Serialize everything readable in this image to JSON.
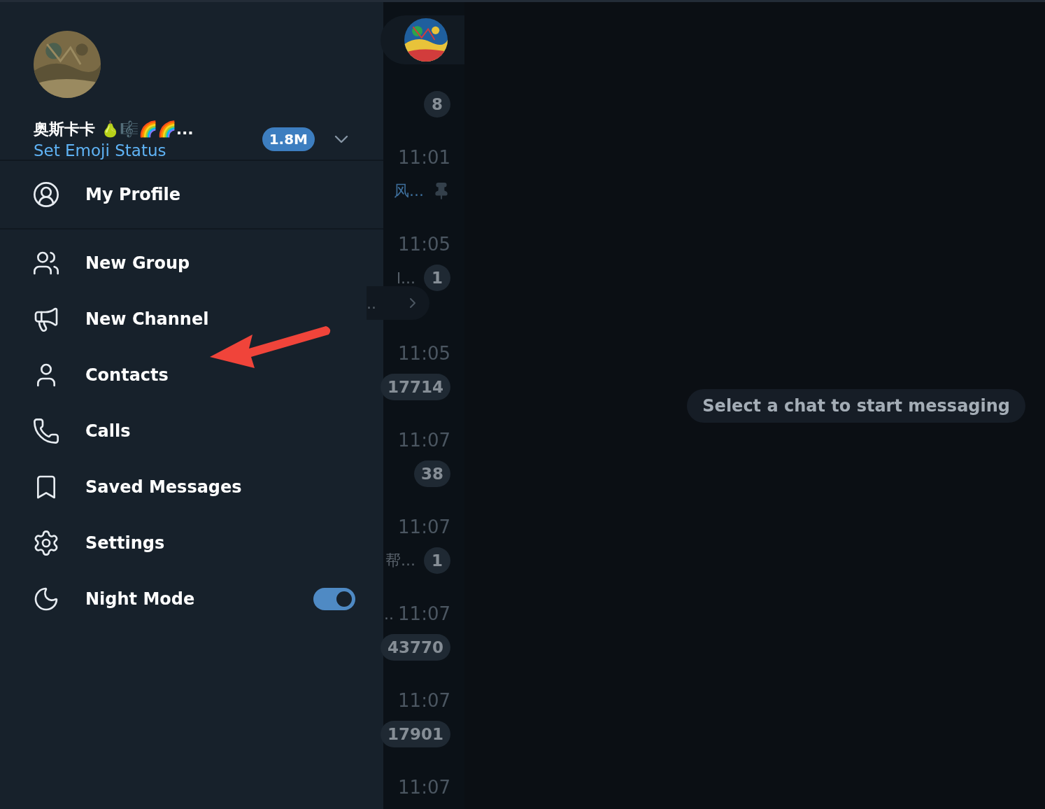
{
  "drawer": {
    "profile": {
      "name": "奥斯卡卡 🍐🎼🌈🌈...",
      "status_link": "Set Emoji Status",
      "badge": "1.8M",
      "expanded": false
    },
    "sections": [
      {
        "items": [
          {
            "label": "My Profile",
            "kind": "link"
          }
        ]
      },
      {
        "items": [
          {
            "label": "New Group",
            "kind": "link"
          },
          {
            "label": "New Channel",
            "kind": "link"
          },
          {
            "label": "Contacts",
            "kind": "link"
          },
          {
            "label": "Calls",
            "kind": "link"
          },
          {
            "label": "Saved Messages",
            "kind": "link"
          },
          {
            "label": "Settings",
            "kind": "link"
          },
          {
            "label": "Night Mode",
            "kind": "toggle",
            "on": true
          }
        ]
      }
    ]
  },
  "chat_list": [
    {
      "kind": "avatar"
    },
    {
      "kind": "meta",
      "badge": "8"
    },
    {
      "kind": "time",
      "time": "11:01"
    },
    {
      "kind": "meta",
      "snippet": "风...",
      "snippet_link": true,
      "pinned": true
    },
    {
      "kind": "time",
      "time": "11:05"
    },
    {
      "kind": "meta",
      "snippet": "l...",
      "badge": "1"
    },
    {
      "kind": "more",
      "snippet": ".."
    },
    {
      "kind": "time",
      "time": "11:05"
    },
    {
      "kind": "meta",
      "badge": "17714"
    },
    {
      "kind": "time",
      "time": "11:07"
    },
    {
      "kind": "meta",
      "badge": "38"
    },
    {
      "kind": "time",
      "time": "11:07"
    },
    {
      "kind": "meta",
      "snippet": "帮...",
      "badge": "1"
    },
    {
      "kind": "time",
      "snippet": "..",
      "time": "11:07"
    },
    {
      "kind": "meta",
      "badge": "43770"
    },
    {
      "kind": "time",
      "time": "11:07"
    },
    {
      "kind": "meta",
      "badge": "17901"
    },
    {
      "kind": "time",
      "time": "11:07"
    }
  ],
  "empty_state": "Select a chat to start messaging"
}
